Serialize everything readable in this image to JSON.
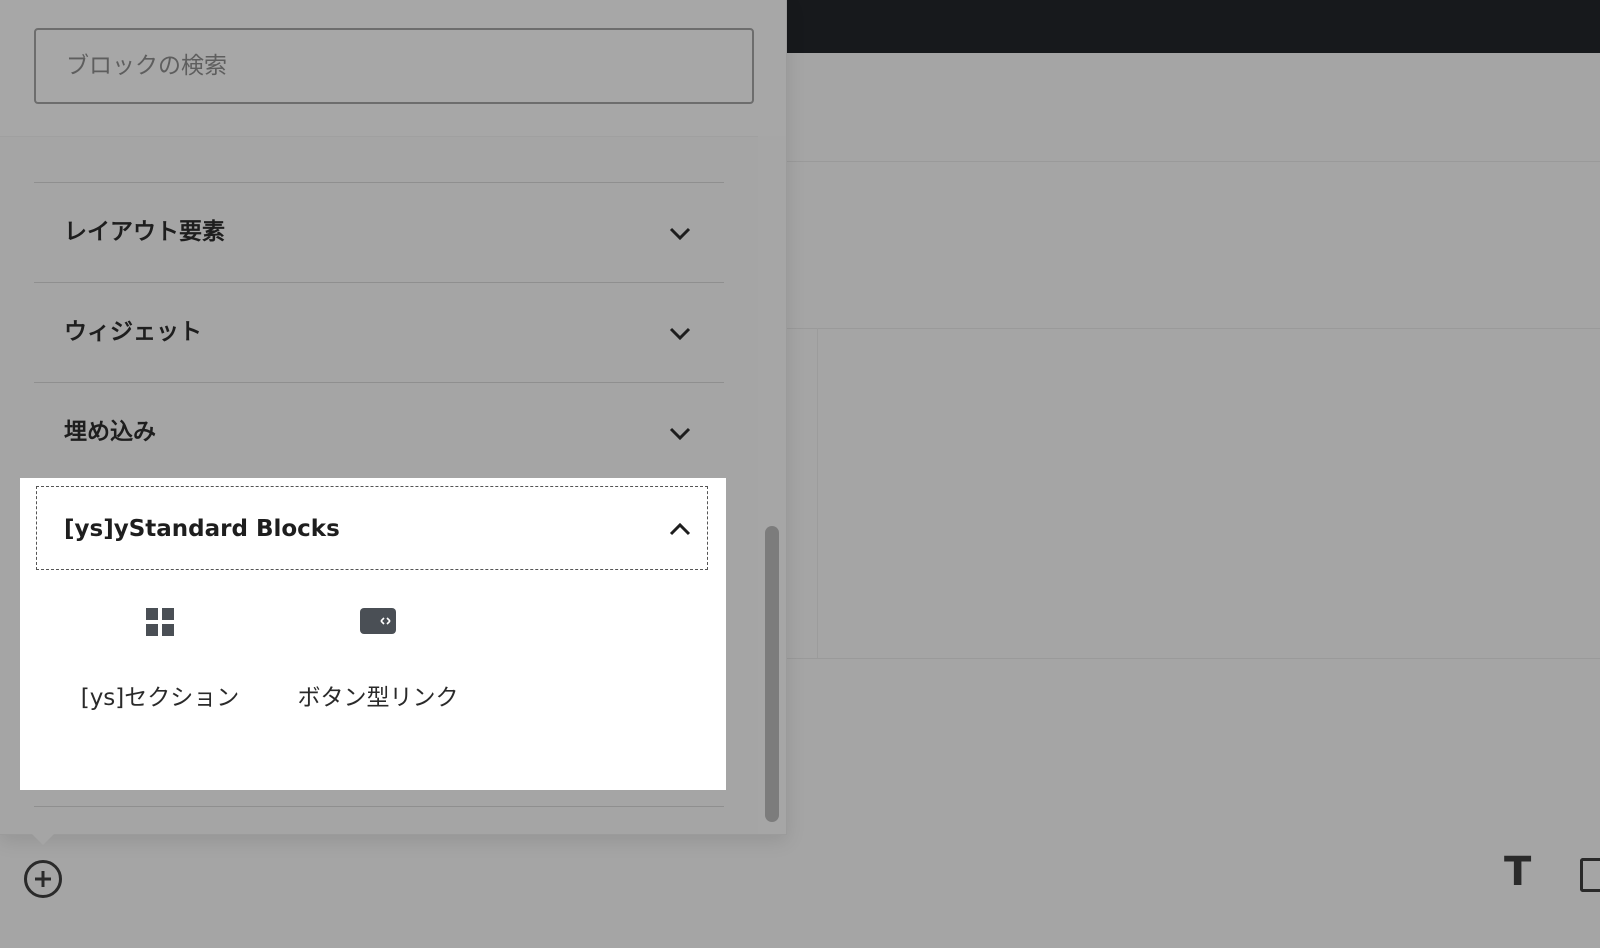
{
  "search": {
    "placeholder": "ブロックの検索"
  },
  "categories": [
    {
      "label": "レイアウト要素",
      "expanded": false
    },
    {
      "label": "ウィジェット",
      "expanded": false
    },
    {
      "label": "埋め込み",
      "expanded": false
    },
    {
      "label": "[ys]yStandard Blocks",
      "expanded": true
    }
  ],
  "blocks": [
    {
      "label": "[ys]セクション",
      "icon": "grid-icon"
    },
    {
      "label": "ボタン型リンク",
      "icon": "button-link-icon"
    }
  ],
  "toolbar": {
    "text_tool": "T"
  },
  "colors": {
    "overlay": "#a5a5a5",
    "topbar": "#17191c",
    "panel_highlight": "#ffffff"
  }
}
